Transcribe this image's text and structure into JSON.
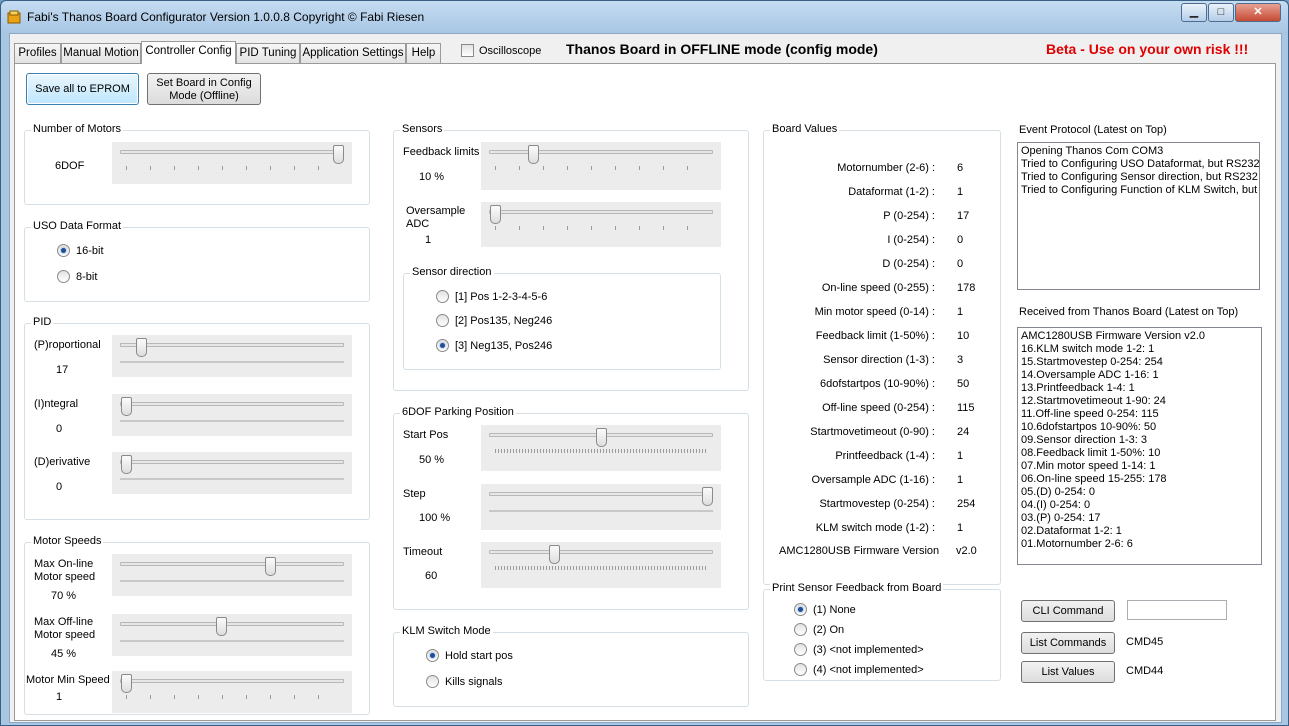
{
  "window": {
    "title": "Fabi's Thanos Board Configurator Version 1.0.0.8 Copyright © Fabi Riesen",
    "minimize_glyph": "▁",
    "maximize_glyph": "□",
    "close_glyph": "✕"
  },
  "tabs": [
    "Profiles",
    "Manual Motion",
    "Controller Config",
    "PID Tuning",
    "Application Settings",
    "Help"
  ],
  "header": {
    "oscilloscope_label": "Oscilloscope",
    "mode_text": "Thanos Board in OFFLINE mode (config mode)",
    "beta_text": "Beta - Use on your own risk !!!"
  },
  "toolbar": {
    "save_label": "Save all to EPROM",
    "config_mode_label": "Set Board in Config Mode (Offline)"
  },
  "motors": {
    "title": "Number of Motors",
    "value_label": "6DOF"
  },
  "uso": {
    "title": "USO Data Format",
    "option_16": "16-bit",
    "option_8": "8-bit",
    "selected": "16-bit"
  },
  "pid": {
    "title": "PID",
    "p_label": "(P)roportional",
    "p_value": "17",
    "i_label": "(I)ntegral",
    "i_value": "0",
    "d_label": "(D)erivative",
    "d_value": "0"
  },
  "speeds": {
    "title": "Motor Speeds",
    "max_online_label": "Max On-line Motor speed",
    "max_online_value": "70   %",
    "max_offline_label": "Max Off-line Motor speed",
    "max_offline_value": "45   %",
    "min_label": "Motor Min Speed",
    "min_value": "1"
  },
  "sensors": {
    "title": "Sensors",
    "feedback_label": "Feedback limits",
    "feedback_value": "10   %",
    "oversample_label": "Oversample ADC",
    "oversample_value": "1",
    "direction_title": "Sensor direction",
    "direction_options": [
      "[1]   Pos 1-2-3-4-5-6",
      "[2]   Pos135, Neg246",
      "[3]   Neg135, Pos246"
    ],
    "direction_selected": 2
  },
  "parking": {
    "title": "6DOF Parking Position",
    "start_label": "Start Pos",
    "start_value": "50   %",
    "step_label": "Step",
    "step_value": "100 %",
    "timeout_label": "Timeout",
    "timeout_value": "60"
  },
  "klm": {
    "title": "KLM Switch Mode",
    "option_hold": "Hold start pos",
    "option_kill": "Kills signals",
    "selected": "Hold start pos"
  },
  "board_values": {
    "title": "Board Values",
    "rows": [
      {
        "label": "Motornumber (2-6) :",
        "value": "6"
      },
      {
        "label": "Dataformat (1-2) :",
        "value": "1"
      },
      {
        "label": "P (0-254) :",
        "value": "17"
      },
      {
        "label": "I (0-254) :",
        "value": "0"
      },
      {
        "label": "D (0-254) :",
        "value": "0"
      },
      {
        "label": "On-line speed (0-255) :",
        "value": "178"
      },
      {
        "label": "Min motor speed (0-14) :",
        "value": "1"
      },
      {
        "label": "Feedback limit (1-50%) :",
        "value": "10"
      },
      {
        "label": "Sensor direction (1-3) :",
        "value": "3"
      },
      {
        "label": "6dofstartpos (10-90%) :",
        "value": "50"
      },
      {
        "label": "Off-line speed (0-254) :",
        "value": "115"
      },
      {
        "label": "Startmovetimeout (0-90) :",
        "value": "24"
      },
      {
        "label": "Printfeedback  (1-4) :",
        "value": "1"
      },
      {
        "label": "Oversample ADC (1-16) :",
        "value": "1"
      },
      {
        "label": "Startmovestep (0-254) :",
        "value": "254"
      },
      {
        "label": "KLM switch mode (1-2) :",
        "value": "1"
      }
    ],
    "firmware_label": "AMC1280USB Firmware Version",
    "firmware_value": "v2.0"
  },
  "print_feedback": {
    "title": "Print Sensor Feedback from Board",
    "options": [
      "(1) None",
      "(2) On",
      "(3)  <not implemented>",
      "(4)  <not implemented>"
    ],
    "selected": 0
  },
  "event_protocol": {
    "title": "Event Protocol (Latest on Top)",
    "lines": [
      "Opening Thanos Com COM3",
      "Tried to Configuring USO Dataformat, but RS232 was not ready",
      "Tried to Configuring Sensor direction, but RS232 was not ready",
      "Tried to Configuring Function of KLM Switch, but RS232 was not ready"
    ]
  },
  "received": {
    "title": "Received from Thanos Board (Latest on Top)",
    "lines": [
      "AMC1280USB Firmware Version v2.0",
      "16.KLM switch mode 1-2: 1",
      "15.Startmovestep 0-254: 254",
      "14.Oversample ADC 1-16: 1",
      "13.Printfeedback  1-4: 1",
      "12.Startmovetimeout 1-90: 24",
      "11.Off-line speed 0-254: 115",
      "10.6dofstartpos 10-90%: 50",
      "09.Sensor direction 1-3: 3",
      "08.Feedback limit 1-50%: 10",
      "07.Min motor speed 1-14: 1",
      "06.On-line speed 15-255: 178",
      "05.(D) 0-254: 0",
      "04.(I) 0-254: 0",
      "03.(P) 0-254: 17",
      "02.Dataformat 1-2: 1",
      "01.Motornumber 2-6: 6"
    ]
  },
  "commands": {
    "cli_label": "CLI Command",
    "cli_input_value": "",
    "list_commands_label": "List Commands",
    "list_commands_code": "CMD45",
    "list_values_label": "List Values",
    "list_values_code": "CMD44"
  },
  "sliders": {
    "motors": 1.0,
    "pid_p": 0.07,
    "pid_i": 0.0,
    "pid_d": 0.0,
    "max_online": 0.68,
    "max_offline": 0.45,
    "min_speed": 0.0,
    "feedback": 0.18,
    "oversample": 0.0,
    "start_pos": 0.5,
    "step": 1.0,
    "timeout": 0.28
  }
}
